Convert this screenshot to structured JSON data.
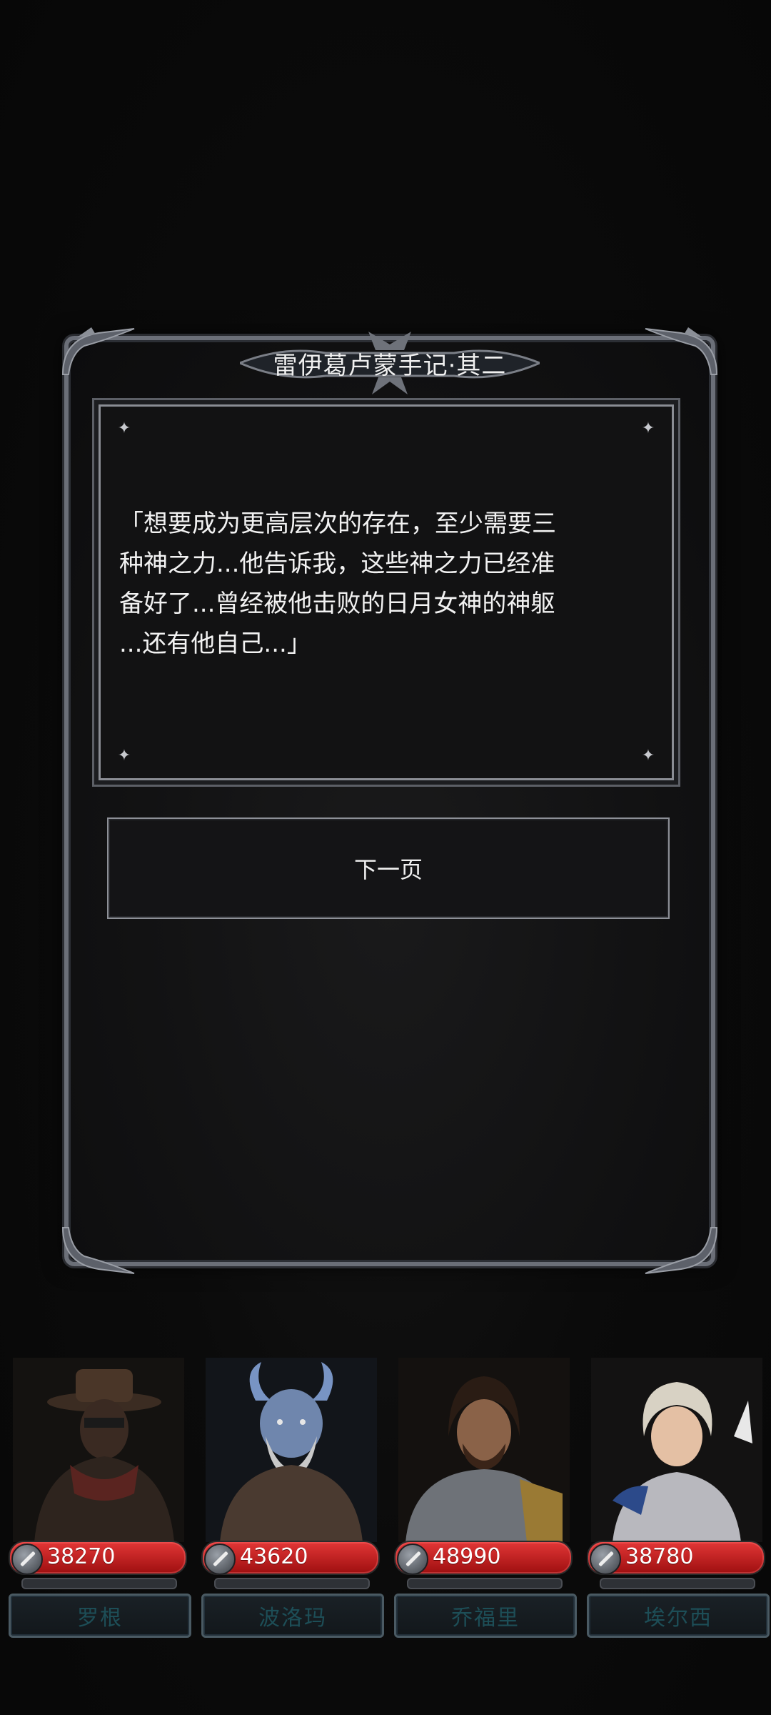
{
  "dialog": {
    "title": "雷伊葛卢蒙手记·其二",
    "story": "「想要成为更高层次的存在，至少需要三\n种神之力...他告诉我，这些神之力已经准\n备好了...曾经被他击败的日月女神的神躯\n...还有他自己...」",
    "next_label": "下一页"
  },
  "characters": [
    {
      "name": "罗根",
      "power": "38270"
    },
    {
      "name": "波洛玛",
      "power": "43620"
    },
    {
      "name": "乔福里",
      "power": "48990"
    },
    {
      "name": "埃尔西",
      "power": "38780"
    }
  ]
}
